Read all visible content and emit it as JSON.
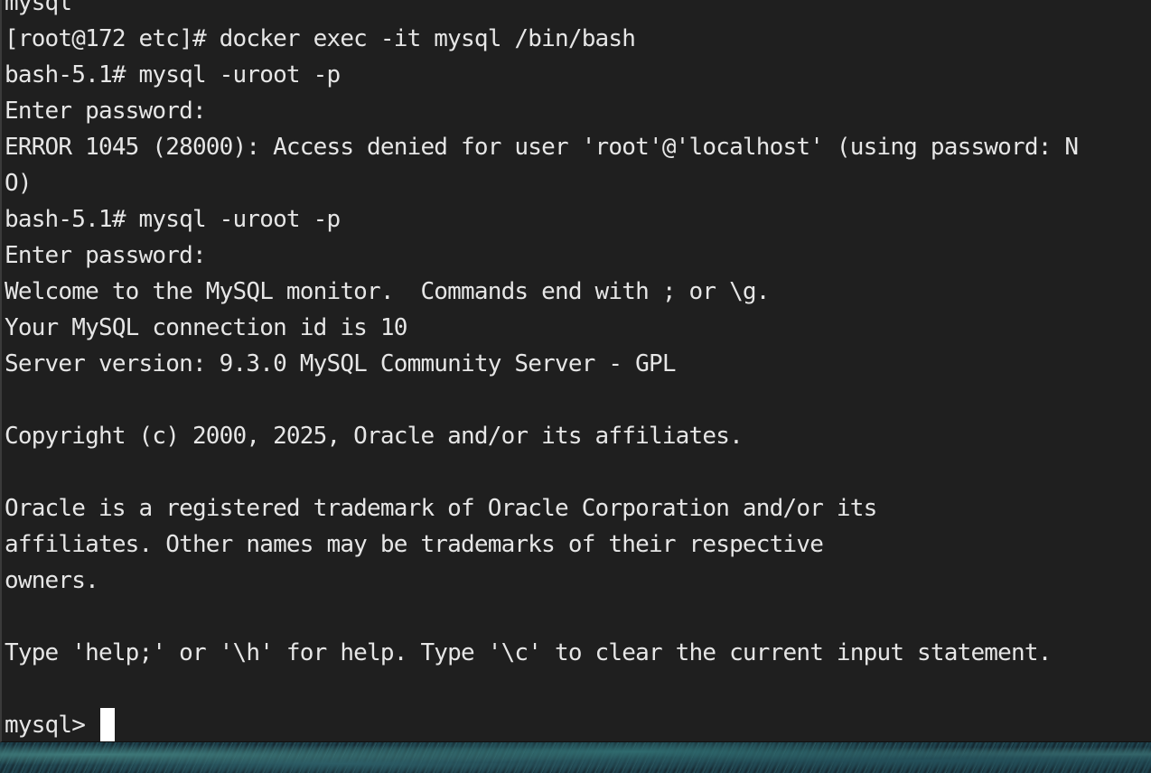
{
  "terminal": {
    "lines": [
      "mysql",
      "[root@172 etc]# docker exec -it mysql /bin/bash",
      "bash-5.1# mysql -uroot -p",
      "Enter password:",
      "ERROR 1045 (28000): Access denied for user 'root'@'localhost' (using password: N",
      "O)",
      "bash-5.1# mysql -uroot -p",
      "Enter password:",
      "Welcome to the MySQL monitor.  Commands end with ; or \\g.",
      "Your MySQL connection id is 10",
      "Server version: 9.3.0 MySQL Community Server - GPL",
      "",
      "Copyright (c) 2000, 2025, Oracle and/or its affiliates.",
      "",
      "Oracle is a registered trademark of Oracle Corporation and/or its",
      "affiliates. Other names may be trademarks of their respective",
      "owners.",
      "",
      "Type 'help;' or '\\h' for help. Type '\\c' to clear the current input statement.",
      ""
    ],
    "prompt": "mysql>",
    "colors": {
      "background": "#1f1f1f",
      "foreground": "#e6e6e6",
      "cursor": "#ffffff"
    }
  }
}
